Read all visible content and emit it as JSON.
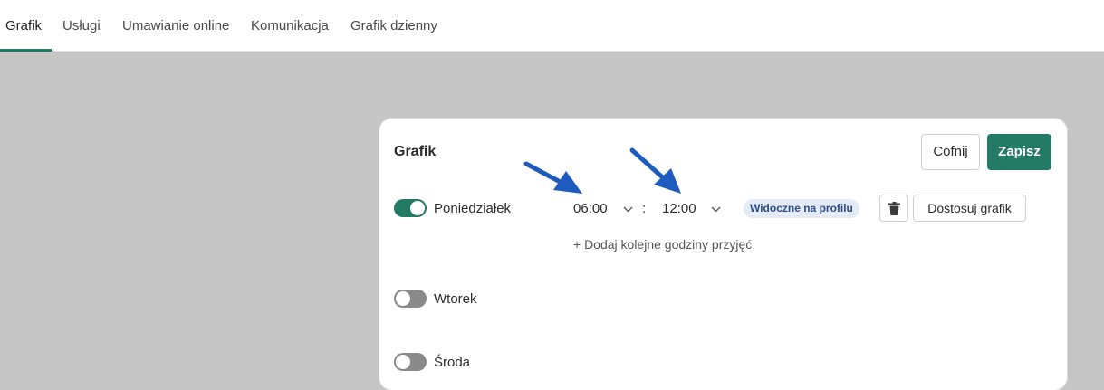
{
  "tabs": [
    {
      "label": "Grafik",
      "active": true
    },
    {
      "label": "Usługi",
      "active": false
    },
    {
      "label": "Umawianie online",
      "active": false
    },
    {
      "label": "Komunikacja",
      "active": false
    },
    {
      "label": "Grafik dzienny",
      "active": false
    }
  ],
  "panel": {
    "title": "Grafik",
    "undo_label": "Cofnij",
    "save_label": "Zapisz",
    "monday": {
      "enabled": true,
      "label": "Poniedziałek",
      "start_time": "06:00",
      "separator": ":",
      "end_time": "12:00",
      "badge": "Widoczne na profilu",
      "delete_icon": "trash-icon",
      "adjust_label": "Dostosuj grafik",
      "add_hours_label": "+ Dodaj kolejne godziny przyjęć"
    },
    "tuesday": {
      "enabled": false,
      "label": "Wtorek"
    },
    "wednesday": {
      "enabled": false,
      "label": "Środa"
    }
  },
  "colors": {
    "accent": "#237a65",
    "background": "#c6c6c6",
    "badge_bg": "#e4ebf7",
    "badge_text": "#2f4c86",
    "annotation_arrow": "#1e5bbf"
  }
}
